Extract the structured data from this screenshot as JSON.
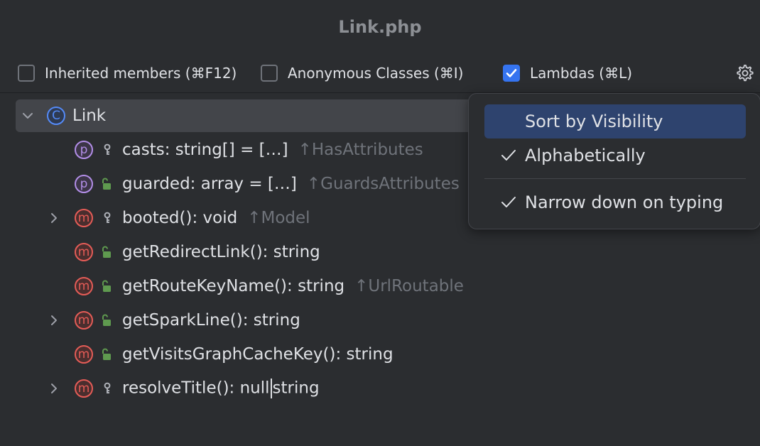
{
  "window": {
    "title": "Link.php"
  },
  "toolbar": {
    "inherited": {
      "label": "Inherited members (⌘F12)",
      "checked": false
    },
    "anonymous": {
      "label": "Anonymous Classes (⌘I)",
      "checked": false
    },
    "lambdas": {
      "label": "Lambdas (⌘L)",
      "checked": true
    },
    "settings_icon": "gear-icon"
  },
  "tree": {
    "root": {
      "kind": "C",
      "name": "Link",
      "expanded": true
    },
    "items": [
      {
        "kind": "p",
        "visibility": "protected",
        "name": "casts: string[] = […]",
        "origin": "↑HasAttributes",
        "expandable": false
      },
      {
        "kind": "p",
        "visibility": "public",
        "name": "guarded: array = […]",
        "origin": "↑GuardsAttributes",
        "expandable": false
      },
      {
        "kind": "m",
        "visibility": "protected",
        "name": "booted(): void",
        "origin": "↑Model",
        "expandable": true
      },
      {
        "kind": "m",
        "visibility": "public",
        "name": "getRedirectLink(): string",
        "origin": "",
        "expandable": false
      },
      {
        "kind": "m",
        "visibility": "public",
        "name": "getRouteKeyName(): string",
        "origin": "↑UrlRoutable",
        "expandable": false
      },
      {
        "kind": "m",
        "visibility": "public",
        "name": "getSparkLine(): string",
        "origin": "",
        "expandable": true
      },
      {
        "kind": "m",
        "visibility": "public",
        "name": "getVisitsGraphCacheKey(): string",
        "origin": "",
        "expandable": false
      },
      {
        "kind": "m",
        "visibility": "protected",
        "name_before_caret": "resolveTitle(): null",
        "name_after_caret": "string",
        "origin": "",
        "expandable": true
      }
    ]
  },
  "popup": {
    "items": [
      {
        "label": "Sort by Visibility",
        "checked": false,
        "selected": true
      },
      {
        "label": "Alphabetically",
        "checked": true,
        "selected": false
      },
      {
        "label": "Narrow down on typing",
        "checked": true,
        "selected": false
      }
    ]
  },
  "colors": {
    "background": "#2b2d30",
    "selection_row": "#43454a",
    "popup_selected": "#2e436e",
    "checkbox_accent": "#3574f0",
    "property_badge": "#b38ee8",
    "method_badge": "#e55c57",
    "class_badge": "#548af7",
    "public_lock": "#5f9a4f"
  }
}
